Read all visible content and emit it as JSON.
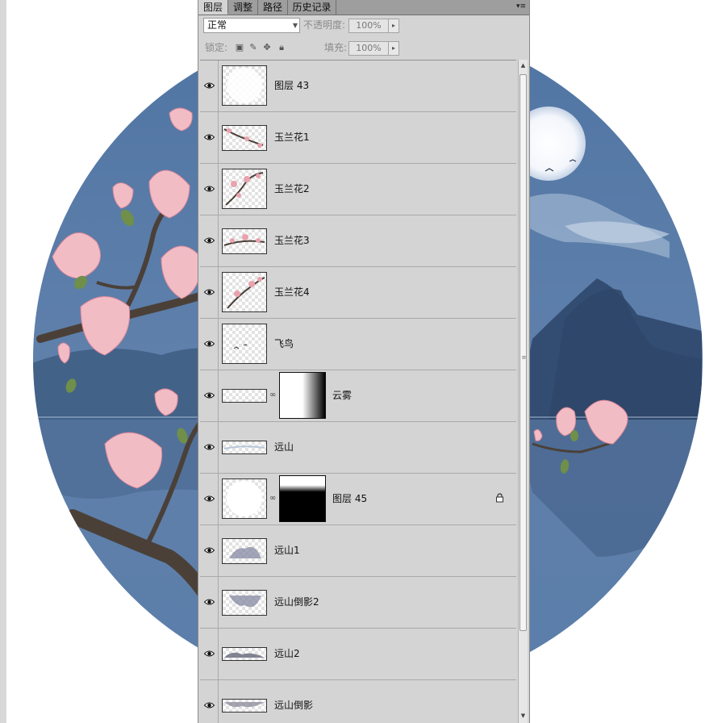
{
  "panel": {
    "tabs": [
      {
        "label": "图层",
        "active": true
      },
      {
        "label": "调整",
        "active": false
      },
      {
        "label": "路径",
        "active": false
      },
      {
        "label": "历史记录",
        "active": false
      }
    ],
    "menu_icon": "panel-menu-icon"
  },
  "blend": {
    "mode": "正常"
  },
  "opacity": {
    "label": "不透明度:",
    "value": "100%"
  },
  "lock": {
    "label": "锁定:",
    "icons": [
      "lock-transparent-icon",
      "lock-brush-icon",
      "lock-move-icon",
      "lock-all-icon"
    ]
  },
  "fill": {
    "label": "填充:",
    "value": "100%"
  },
  "layers": [
    {
      "name": "图层 43",
      "visible": true,
      "has_mask": false
    },
    {
      "name": "玉兰花1",
      "visible": true,
      "has_mask": false
    },
    {
      "name": "玉兰花2",
      "visible": true,
      "has_mask": false
    },
    {
      "name": "玉兰花3",
      "visible": true,
      "has_mask": false
    },
    {
      "name": "玉兰花4",
      "visible": true,
      "has_mask": false
    },
    {
      "name": "飞鸟",
      "visible": true,
      "has_mask": false
    },
    {
      "name": "云雾",
      "visible": true,
      "has_mask": true
    },
    {
      "name": "远山",
      "visible": true,
      "has_mask": false
    },
    {
      "name": "图层 45",
      "visible": true,
      "has_mask": true,
      "locked": true
    },
    {
      "name": "远山1",
      "visible": true,
      "has_mask": false
    },
    {
      "name": "远山倒影2",
      "visible": true,
      "has_mask": false
    },
    {
      "name": "远山2",
      "visible": true,
      "has_mask": false
    },
    {
      "name": "远山倒影",
      "visible": true,
      "has_mask": false
    }
  ],
  "colors": {
    "sky": "#5b7ea8",
    "panel": "#d4d4d4",
    "blossom": "#f0b8c0"
  }
}
